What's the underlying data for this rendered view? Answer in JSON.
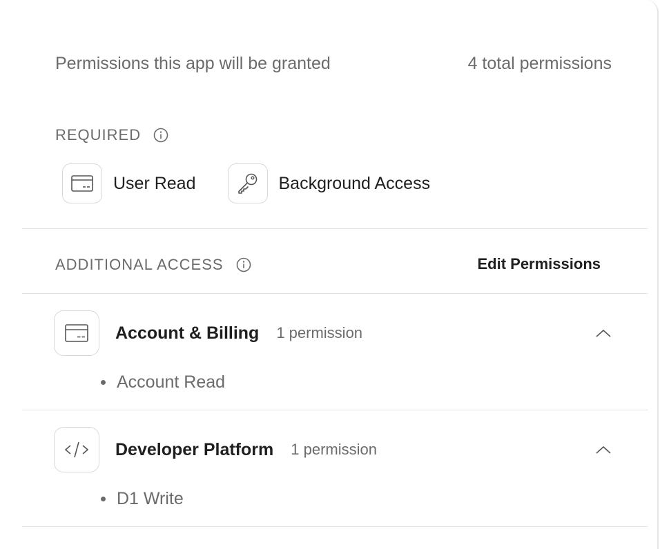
{
  "header": {
    "title": "Permissions this app will be granted",
    "total": "4 total permissions"
  },
  "required": {
    "label": "REQUIRED",
    "items": [
      {
        "label": "User Read",
        "icon": "card-icon"
      },
      {
        "label": "Background Access",
        "icon": "key-icon"
      }
    ]
  },
  "additional": {
    "label": "ADDITIONAL ACCESS",
    "edit_label": "Edit Permissions",
    "groups": [
      {
        "title": "Account & Billing",
        "count": "1 permission",
        "icon": "card-icon",
        "items": [
          "Account Read"
        ]
      },
      {
        "title": "Developer Platform",
        "count": "1 permission",
        "icon": "code-icon",
        "items": [
          "D1 Write"
        ]
      }
    ]
  }
}
